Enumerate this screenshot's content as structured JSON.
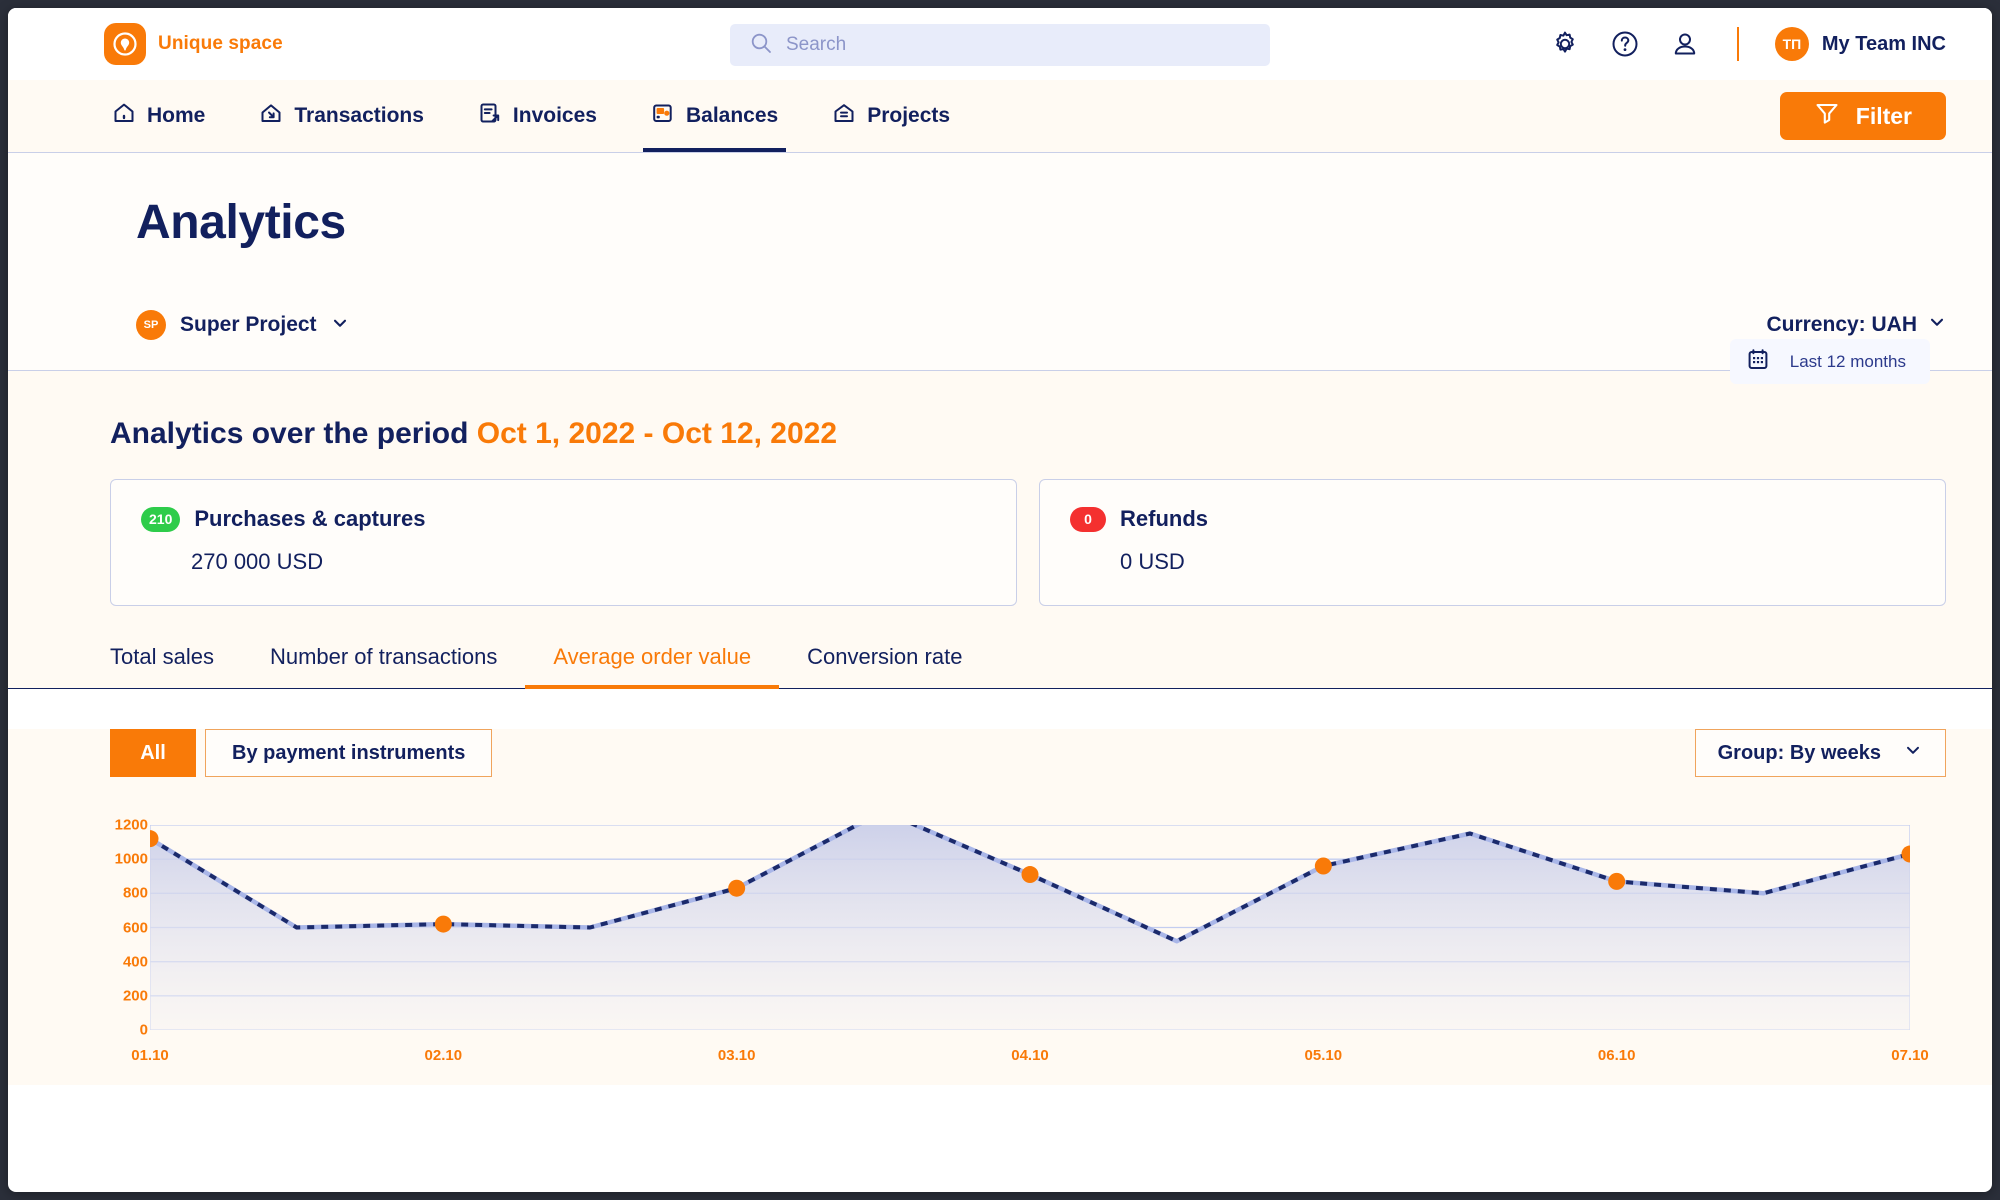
{
  "brand": {
    "name": "Unique space",
    "logo_icon": "location-pin-icon"
  },
  "search": {
    "placeholder": "Search",
    "value": "",
    "icon": "search-icon"
  },
  "topbar": {
    "settings_icon": "gear-icon",
    "help_icon": "question-circle-icon",
    "account_icon": "user-icon",
    "team_initials": "ТП",
    "team_name": "My Team INC"
  },
  "nav": {
    "items": [
      {
        "label": "Home",
        "icon": "home-icon",
        "active": false
      },
      {
        "label": "Transactions",
        "icon": "transactions-icon",
        "active": false
      },
      {
        "label": "Invoices",
        "icon": "invoice-icon",
        "active": false
      },
      {
        "label": "Balances",
        "icon": "wallet-icon",
        "active": true
      },
      {
        "label": "Projects",
        "icon": "projects-icon",
        "active": false
      }
    ],
    "filter_label": "Filter",
    "filter_icon": "funnel-icon"
  },
  "page": {
    "title": "Analytics",
    "date_range_chip": {
      "label": "Last 12 months",
      "icon": "calendar-icon"
    },
    "project": {
      "initials": "SP",
      "name": "Super Project",
      "chevron": "chevron-down-icon"
    },
    "currency": {
      "label": "Currency: UAH",
      "chevron": "chevron-down-icon"
    }
  },
  "analytics": {
    "period_prefix": "Analytics over the period",
    "period_range": "Oct 1, 2022 - Oct 12, 2022",
    "cards": [
      {
        "badge": "210",
        "badge_color": "#2ecc4a",
        "title": "Purchases & captures",
        "value": "270 000 USD"
      },
      {
        "badge": "0",
        "badge_color": "#f4302f",
        "title": "Refunds",
        "value": "0 USD"
      }
    ],
    "tabs": [
      {
        "label": "Total sales",
        "active": false
      },
      {
        "label": "Number of transactions",
        "active": false
      },
      {
        "label": "Average order value",
        "active": true
      },
      {
        "label": "Conversion rate",
        "active": false
      }
    ]
  },
  "chart_controls": {
    "segments": [
      {
        "label": "All",
        "active": true
      },
      {
        "label": "By payment instruments",
        "active": false
      }
    ],
    "group": {
      "label": "Group: By weeks",
      "chevron": "chevron-down-icon"
    }
  },
  "colors": {
    "accent_orange": "#f97a08",
    "navy": "#12205e",
    "line_navy": "#1b2a6b",
    "area_fill": "#c9cdea",
    "grid": "#c3cdf0"
  },
  "chart_data": {
    "type": "line",
    "title": "Average order value",
    "xlabel": "",
    "ylabel": "",
    "ylim": [
      0,
      1200
    ],
    "yticks": [
      0,
      200,
      400,
      600,
      800,
      1000,
      1200
    ],
    "grid": true,
    "legend": false,
    "categories": [
      "01.10",
      "02.10",
      "03.10",
      "04.10",
      "05.10",
      "06.10",
      "07.10"
    ],
    "marker_values": [
      1120,
      620,
      830,
      910,
      960,
      870,
      1030
    ],
    "series": [
      {
        "name": "Average order value",
        "style": "dashed",
        "x": [
          0,
          0.5,
          1,
          1.5,
          2,
          2.5,
          3,
          3.5,
          4,
          4.5,
          5,
          5.5,
          6
        ],
        "values": [
          1120,
          600,
          620,
          600,
          830,
          1280,
          910,
          520,
          960,
          1150,
          870,
          800,
          1030
        ]
      }
    ]
  }
}
